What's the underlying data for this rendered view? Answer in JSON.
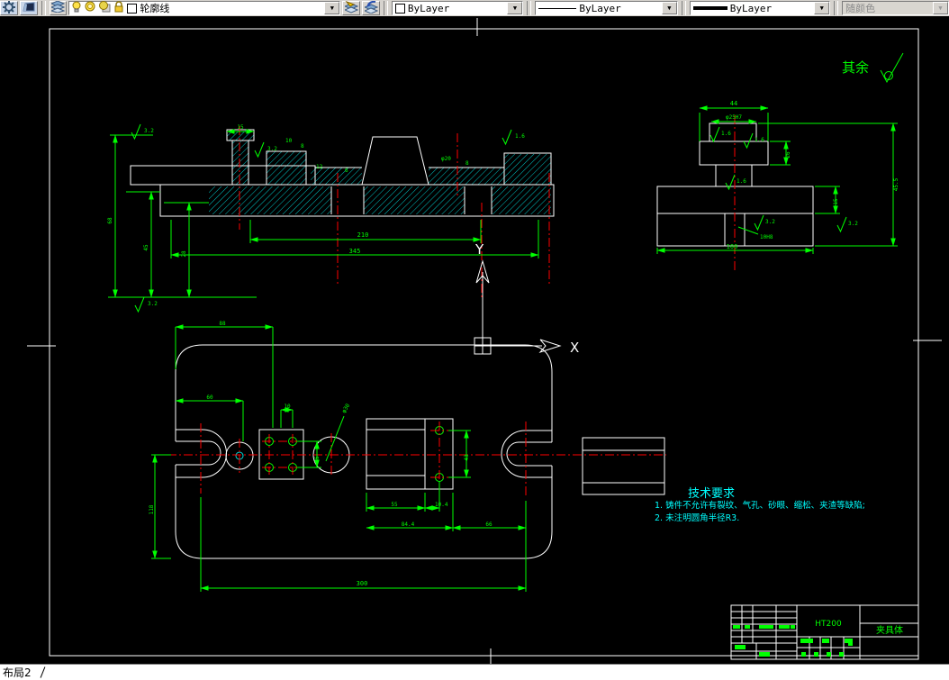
{
  "toolbar": {
    "layer_combo": {
      "layer_name": "轮廓线"
    },
    "color_combo": {
      "value": "ByLayer"
    },
    "linetype_combo": {
      "value": "ByLayer"
    },
    "lineweight_combo": {
      "value": "ByLayer"
    },
    "plot_style_combo": {
      "value": "随颜色"
    },
    "icons": {
      "layer_properties": "gear-icon",
      "layer_states": "layer-states-icon",
      "layers_panel": "layers-icon",
      "layer_on": "bulb-icon",
      "layer_freeze": "sun-icon",
      "layer_vp_freeze": "sun-viewport-icon",
      "layer_lock": "lock-icon",
      "layer_color": "color-swatch",
      "make_object_layer_current": "layers-arrow-icon",
      "layer_previous": "layers-undo-icon",
      "dropdown": "chevron-down-icon"
    }
  },
  "canvas": {
    "surface_note": "其余",
    "ucs": {
      "x": "X",
      "y": "Y"
    },
    "tech": {
      "title": "技术要求",
      "line1": "1. 铸件不允许有裂纹、气孔、砂眼、缩松、夹渣等缺陷;",
      "line2": "2. 未注明圆角半径R3."
    },
    "title_block": {
      "material": "HT200",
      "part_name": "夹具体"
    },
    "front_dims": [
      "210",
      "345",
      "3.2",
      "3.2",
      "3.2",
      "68",
      "45",
      "28",
      "15",
      "10",
      "8",
      "12",
      "6",
      "φ20",
      "8",
      "1.6"
    ],
    "side_dims": [
      "44",
      "φ25H7",
      "1.6",
      "1.6",
      "1.6",
      "3.2",
      "3.2",
      "45.5",
      "15",
      "100",
      "10H8",
      "26"
    ],
    "plan_dims": [
      "88",
      "60",
      "10",
      "25",
      "φ30",
      "43",
      "55",
      "10.4",
      "84.4",
      "66",
      "300",
      "118"
    ],
    "colors": {
      "outline": "#ffffff",
      "dimension": "#00ff00",
      "centerline": "#ff0000",
      "hatch": "#00dcdc",
      "tech_text": "#00ffff",
      "toolbar_bg": "#d6d3ce"
    }
  },
  "status_bar": {
    "layout_tab": "布局2"
  }
}
